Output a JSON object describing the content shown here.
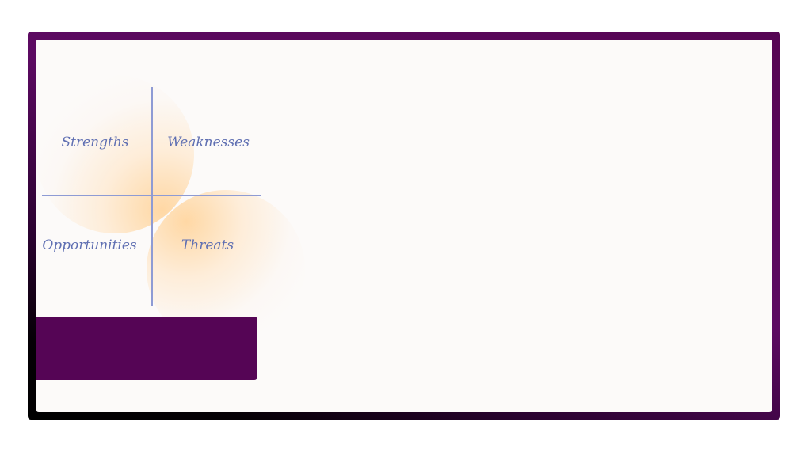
{
  "swot": {
    "strengths": "Strengths",
    "weaknesses": "Weaknesses",
    "opportunities": "Opportunities",
    "threats": "Threats"
  },
  "colors": {
    "frame_top": "#560553",
    "frame_bottom": "#000000",
    "panel_background": "#fcfaf9",
    "axis_line": "#8e9bd4",
    "label_text": "#5f6fb2",
    "highlight_glow": "#ffd6a0",
    "band": "#550555"
  }
}
